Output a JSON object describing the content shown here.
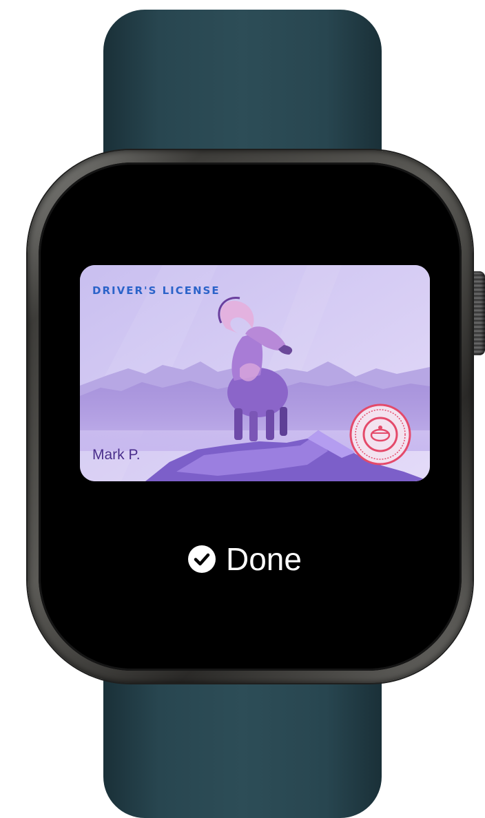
{
  "card": {
    "title": "DRIVER'S LICENSE",
    "holder_name": "Mark P.",
    "illustration": "bighorn-ram-on-mountain",
    "seal": "state-seal",
    "title_color": "#2b63c9",
    "background_color": "#d6ccf3"
  },
  "status": {
    "label": "Done",
    "icon": "checkmark-circle-icon"
  },
  "device": {
    "band_color": "#2d4d57",
    "case_color": "#3e3d3a",
    "screen_color": "#000000"
  }
}
